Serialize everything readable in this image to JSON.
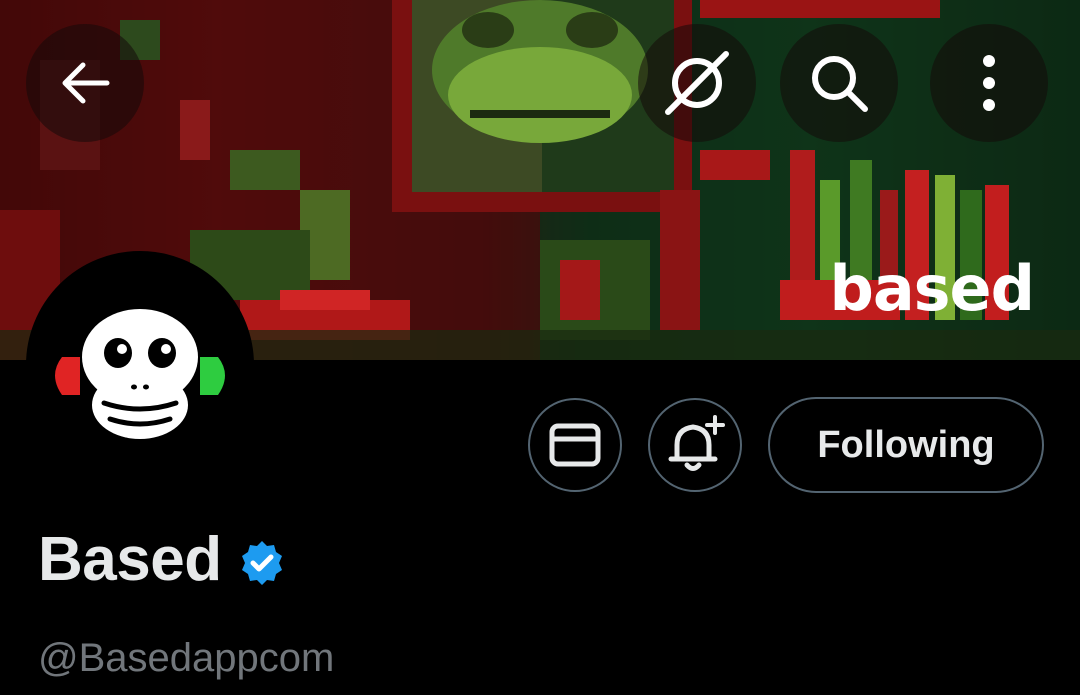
{
  "banner": {
    "word": "based"
  },
  "top_bar": {
    "back": {
      "icon": "arrow-left-icon"
    },
    "grok": {
      "icon": "grok-icon"
    },
    "search": {
      "icon": "search-icon"
    },
    "more": {
      "icon": "more-vertical-icon"
    }
  },
  "profile": {
    "name": "Based",
    "handle": "@Basedappcom",
    "verified": true,
    "avatar_icon": "monkey-headphones-icon"
  },
  "actions": {
    "message_icon": "envelope-icon",
    "notify_icon": "bell-plus-icon",
    "following_label": "Following"
  },
  "colors": {
    "background": "#000000",
    "text": "#e7e9ea",
    "secondary": "#71767b",
    "border": "#536471",
    "verified": "#1d9bf0"
  }
}
